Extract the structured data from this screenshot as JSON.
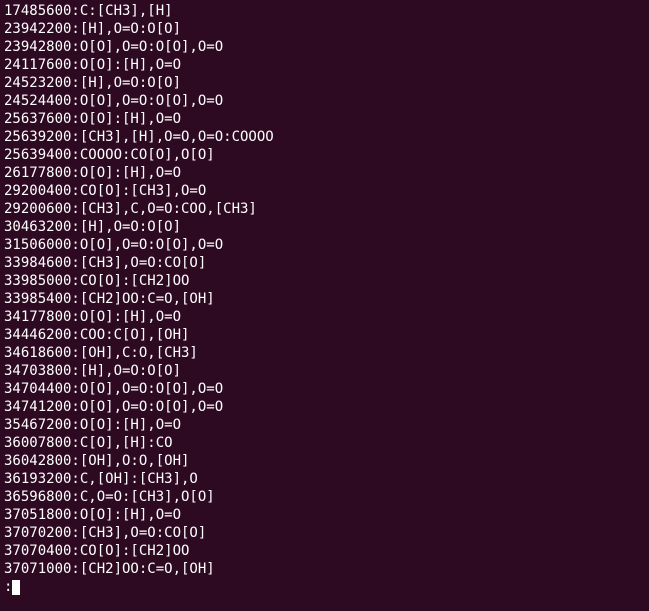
{
  "terminal": {
    "lines": [
      "17485600:C:[CH3],[H]",
      "23942200:[H],O=O:O[O]",
      "23942800:O[O],O=O:O[O],O=O",
      "24117600:O[O]:[H],O=O",
      "24523200:[H],O=O:O[O]",
      "24524400:O[O],O=O:O[O],O=O",
      "25637600:O[O]:[H],O=O",
      "25639200:[CH3],[H],O=O,O=O:COOOO",
      "25639400:COOOO:CO[O],O[O]",
      "26177800:O[O]:[H],O=O",
      "29200400:CO[O]:[CH3],O=O",
      "29200600:[CH3],C,O=O:COO,[CH3]",
      "30463200:[H],O=O:O[O]",
      "31506000:O[O],O=O:O[O],O=O",
      "33984600:[CH3],O=O:CO[O]",
      "33985000:CO[O]:[CH2]OO",
      "33985400:[CH2]OO:C=O,[OH]",
      "34177800:O[O]:[H],O=O",
      "34446200:COO:C[O],[OH]",
      "34618600:[OH],C:O,[CH3]",
      "34703800:[H],O=O:O[O]",
      "34704400:O[O],O=O:O[O],O=O",
      "34741200:O[O],O=O:O[O],O=O",
      "35467200:O[O]:[H],O=O",
      "36007800:C[O],[H]:CO",
      "36042800:[OH],O:O,[OH]",
      "36193200:C,[OH]:[CH3],O",
      "36596800:C,O=O:[CH3],O[O]",
      "37051800:O[O]:[H],O=O",
      "37070200:[CH3],O=O:CO[O]",
      "37070400:CO[O]:[CH2]OO",
      "37071000:[CH2]OO:C=O,[OH]"
    ],
    "prompt": ":"
  }
}
